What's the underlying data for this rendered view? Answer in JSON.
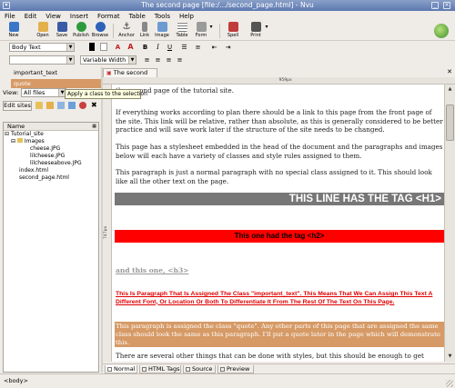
{
  "window": {
    "title": "The second page [file:/.../second_page.html] - Nvu"
  },
  "menu": [
    "File",
    "Edit",
    "View",
    "Insert",
    "Format",
    "Table",
    "Tools",
    "Help"
  ],
  "toolbar": {
    "buttons": [
      {
        "label": "New",
        "icon": "new-page-icon",
        "color": "#3a77c7"
      },
      {
        "label": "Open",
        "icon": "open-folder-icon",
        "color": "#e3b04b"
      },
      {
        "label": "Save",
        "icon": "floppy-icon",
        "color": "#3b5aa6"
      },
      {
        "label": "Publish",
        "icon": "globe-icon",
        "color": "#2e9a3b"
      },
      {
        "label": "Browse",
        "icon": "browse-icon",
        "color": "#2d62b8"
      },
      {
        "label": "Anchor",
        "icon": "anchor-icon",
        "color": "#333333"
      },
      {
        "label": "Link",
        "icon": "link-icon",
        "color": "#888888"
      },
      {
        "label": "Image",
        "icon": "image-icon",
        "color": "#6c9bd2"
      },
      {
        "label": "Table",
        "icon": "table-icon",
        "color": "#7a7a7a"
      },
      {
        "label": "Form",
        "icon": "form-icon",
        "color": "#9a9a9a"
      },
      {
        "label": "Spell",
        "icon": "spell-check-icon",
        "color": "#c23b3b"
      },
      {
        "label": "Print",
        "icon": "printer-icon",
        "color": "#555555"
      }
    ]
  },
  "format": {
    "paragraph_style": "Body Text",
    "width_select": "Variable Width",
    "class_value": ""
  },
  "left_panel": {
    "classes": [
      "important_text",
      "quote"
    ],
    "view_label": "View:",
    "view_select": "All files",
    "edit_sites": "Edit sites",
    "column_header": "Name",
    "tree": [
      {
        "label": "Tutorial_site",
        "level": 0,
        "type": "folder"
      },
      {
        "label": "Images",
        "level": 1,
        "type": "folder"
      },
      {
        "label": "cheese.JPG",
        "level": 2,
        "type": "file"
      },
      {
        "label": "lilcheese.JPG",
        "level": 2,
        "type": "file"
      },
      {
        "label": "lilcheeseabove.JPG",
        "level": 2,
        "type": "file"
      },
      {
        "label": "index.html",
        "level": 1,
        "type": "file"
      },
      {
        "label": "second_page.html",
        "level": 1,
        "type": "file"
      }
    ]
  },
  "tooltip": "Apply a class to the selection",
  "document": {
    "tab_label": "The second page",
    "ruler_label": "959px",
    "vruler_label": "747px",
    "intro": "the second page of the tutorial site.",
    "p1": "If everything works according to plan there should be a link to this page from the front page of the site. This link will be relative, rather than absolute, as this is generally considered to be better practice and will save work later if the structure of the site needs to be changed.",
    "p2": "This page has a stylesheet embedded in the head of the document and the paragraphs and images below will each have a variety of classes and style rules assigned to them.",
    "p3": "This paragraph is just a normal paragraph with no special class assigned to it. This should look like all the other text on the page.",
    "h1": "THIS LINE HAS THE TAG  <H1>",
    "h2": "This one had the tag <h2>",
    "h3": "and this one, <h3>",
    "important": "This Is Paragraph That Is Assigned The Class \"important_text\". This Means That We Can Assign This Text A Different Font, Or Location Or Both To Differentiate It From The Rest Of The Text On This Page.",
    "quote": "This paragraph is assigned the class \"quote\". Any other parts of this page that are assigned the same class should look the same as this paragraph. I'll put a quote later in the page which will demonstrate this.",
    "last": "There are several other things that can be done with styles, but this should be enough to get"
  },
  "view_tabs": [
    "Normal",
    "HTML Tags",
    "Source",
    "Preview"
  ],
  "status": "<body>"
}
